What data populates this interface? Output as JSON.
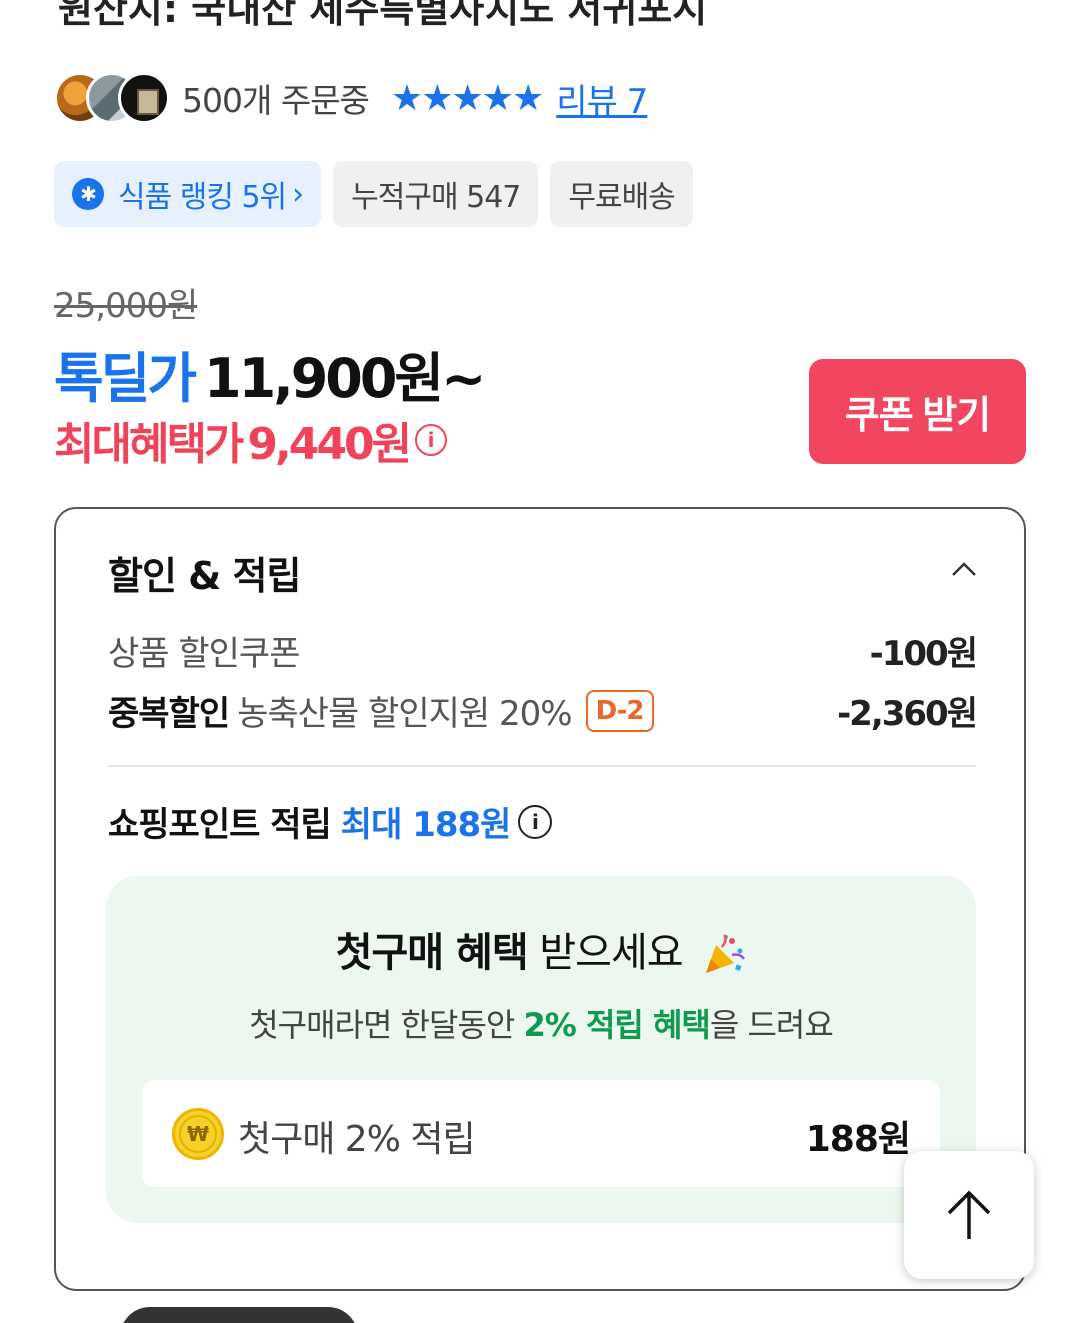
{
  "header": {
    "title_cut": "원산지: 국내산 제주특별자치도 서귀포시"
  },
  "meta": {
    "orders_text": "500개 주문중",
    "stars": "★★★★★",
    "review_link": "리뷰 7"
  },
  "chips": [
    {
      "label": "식품 랭킹 5위"
    },
    {
      "label": "누적구매 547"
    },
    {
      "label": "무료배송"
    }
  ],
  "price": {
    "original": "25,000원",
    "deal_label": "톡딜가",
    "deal_price": "11,900원~",
    "max_label": "최대혜택가",
    "max_price": "9,440원",
    "coupon_button": "쿠폰 받기"
  },
  "discount_card": {
    "title": "할인 & 적립",
    "lines": [
      {
        "strong": "",
        "label": "상품 할인쿠폰",
        "amount": "-100원"
      },
      {
        "strong": "중복할인",
        "label": "농축산물 할인지원 20%",
        "badge": "D-2",
        "amount": "-2,360원"
      }
    ],
    "points_label": "쇼핑포인트 적립",
    "points_max": "최대 188원"
  },
  "first_purchase": {
    "title_bold": "첫구매 혜택",
    "title_rest": " 받으세요",
    "sub_prefix": "첫구매라면 한달동안 ",
    "sub_green": "2% 적립 혜택",
    "sub_suffix": "을 드려요",
    "coin_symbol": "₩",
    "box_label": "첫구매 2% 적립",
    "box_amount": "188원"
  },
  "colors": {
    "accent_blue": "#1a73e8",
    "accent_red": "#f24660",
    "green": "#0e9a4f",
    "promo_bg": "#ecf8ef"
  },
  "icons": {
    "rank_badge": "star-badge-icon",
    "chevron": "chevron-right-icon",
    "info": "info-icon",
    "collapse": "chevron-up-icon",
    "party": "party-popper-icon",
    "coin": "won-coin-icon",
    "scroll_top": "arrow-up-icon"
  }
}
